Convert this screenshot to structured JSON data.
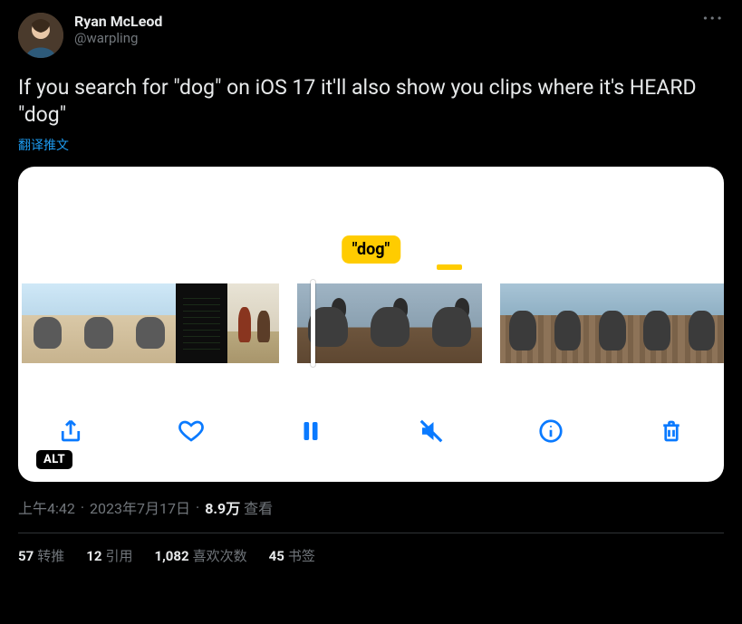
{
  "author": {
    "name": "Ryan McLeod",
    "handle": "@warpling"
  },
  "more_label": "···",
  "body": "If you search for \"dog\" on iOS 17 it'll also show you clips where it's HEARD \"dog\"",
  "translate_label": "翻译推文",
  "media": {
    "search_tag": "\"dog\"",
    "alt_badge": "ALT"
  },
  "toolbar_icons": {
    "share": "share-icon",
    "like": "heart-icon",
    "pause": "pause-icon",
    "mute": "mute-icon",
    "info": "info-icon",
    "delete": "trash-icon"
  },
  "meta": {
    "time": "上午4:42",
    "sep": "·",
    "date": "2023年7月17日",
    "views_num": "8.9万",
    "views_label": "查看"
  },
  "stats": {
    "retweets_n": "57",
    "retweets_l": "转推",
    "quotes_n": "12",
    "quotes_l": "引用",
    "likes_n": "1,082",
    "likes_l": "喜欢次数",
    "bookmarks_n": "45",
    "bookmarks_l": "书签"
  }
}
